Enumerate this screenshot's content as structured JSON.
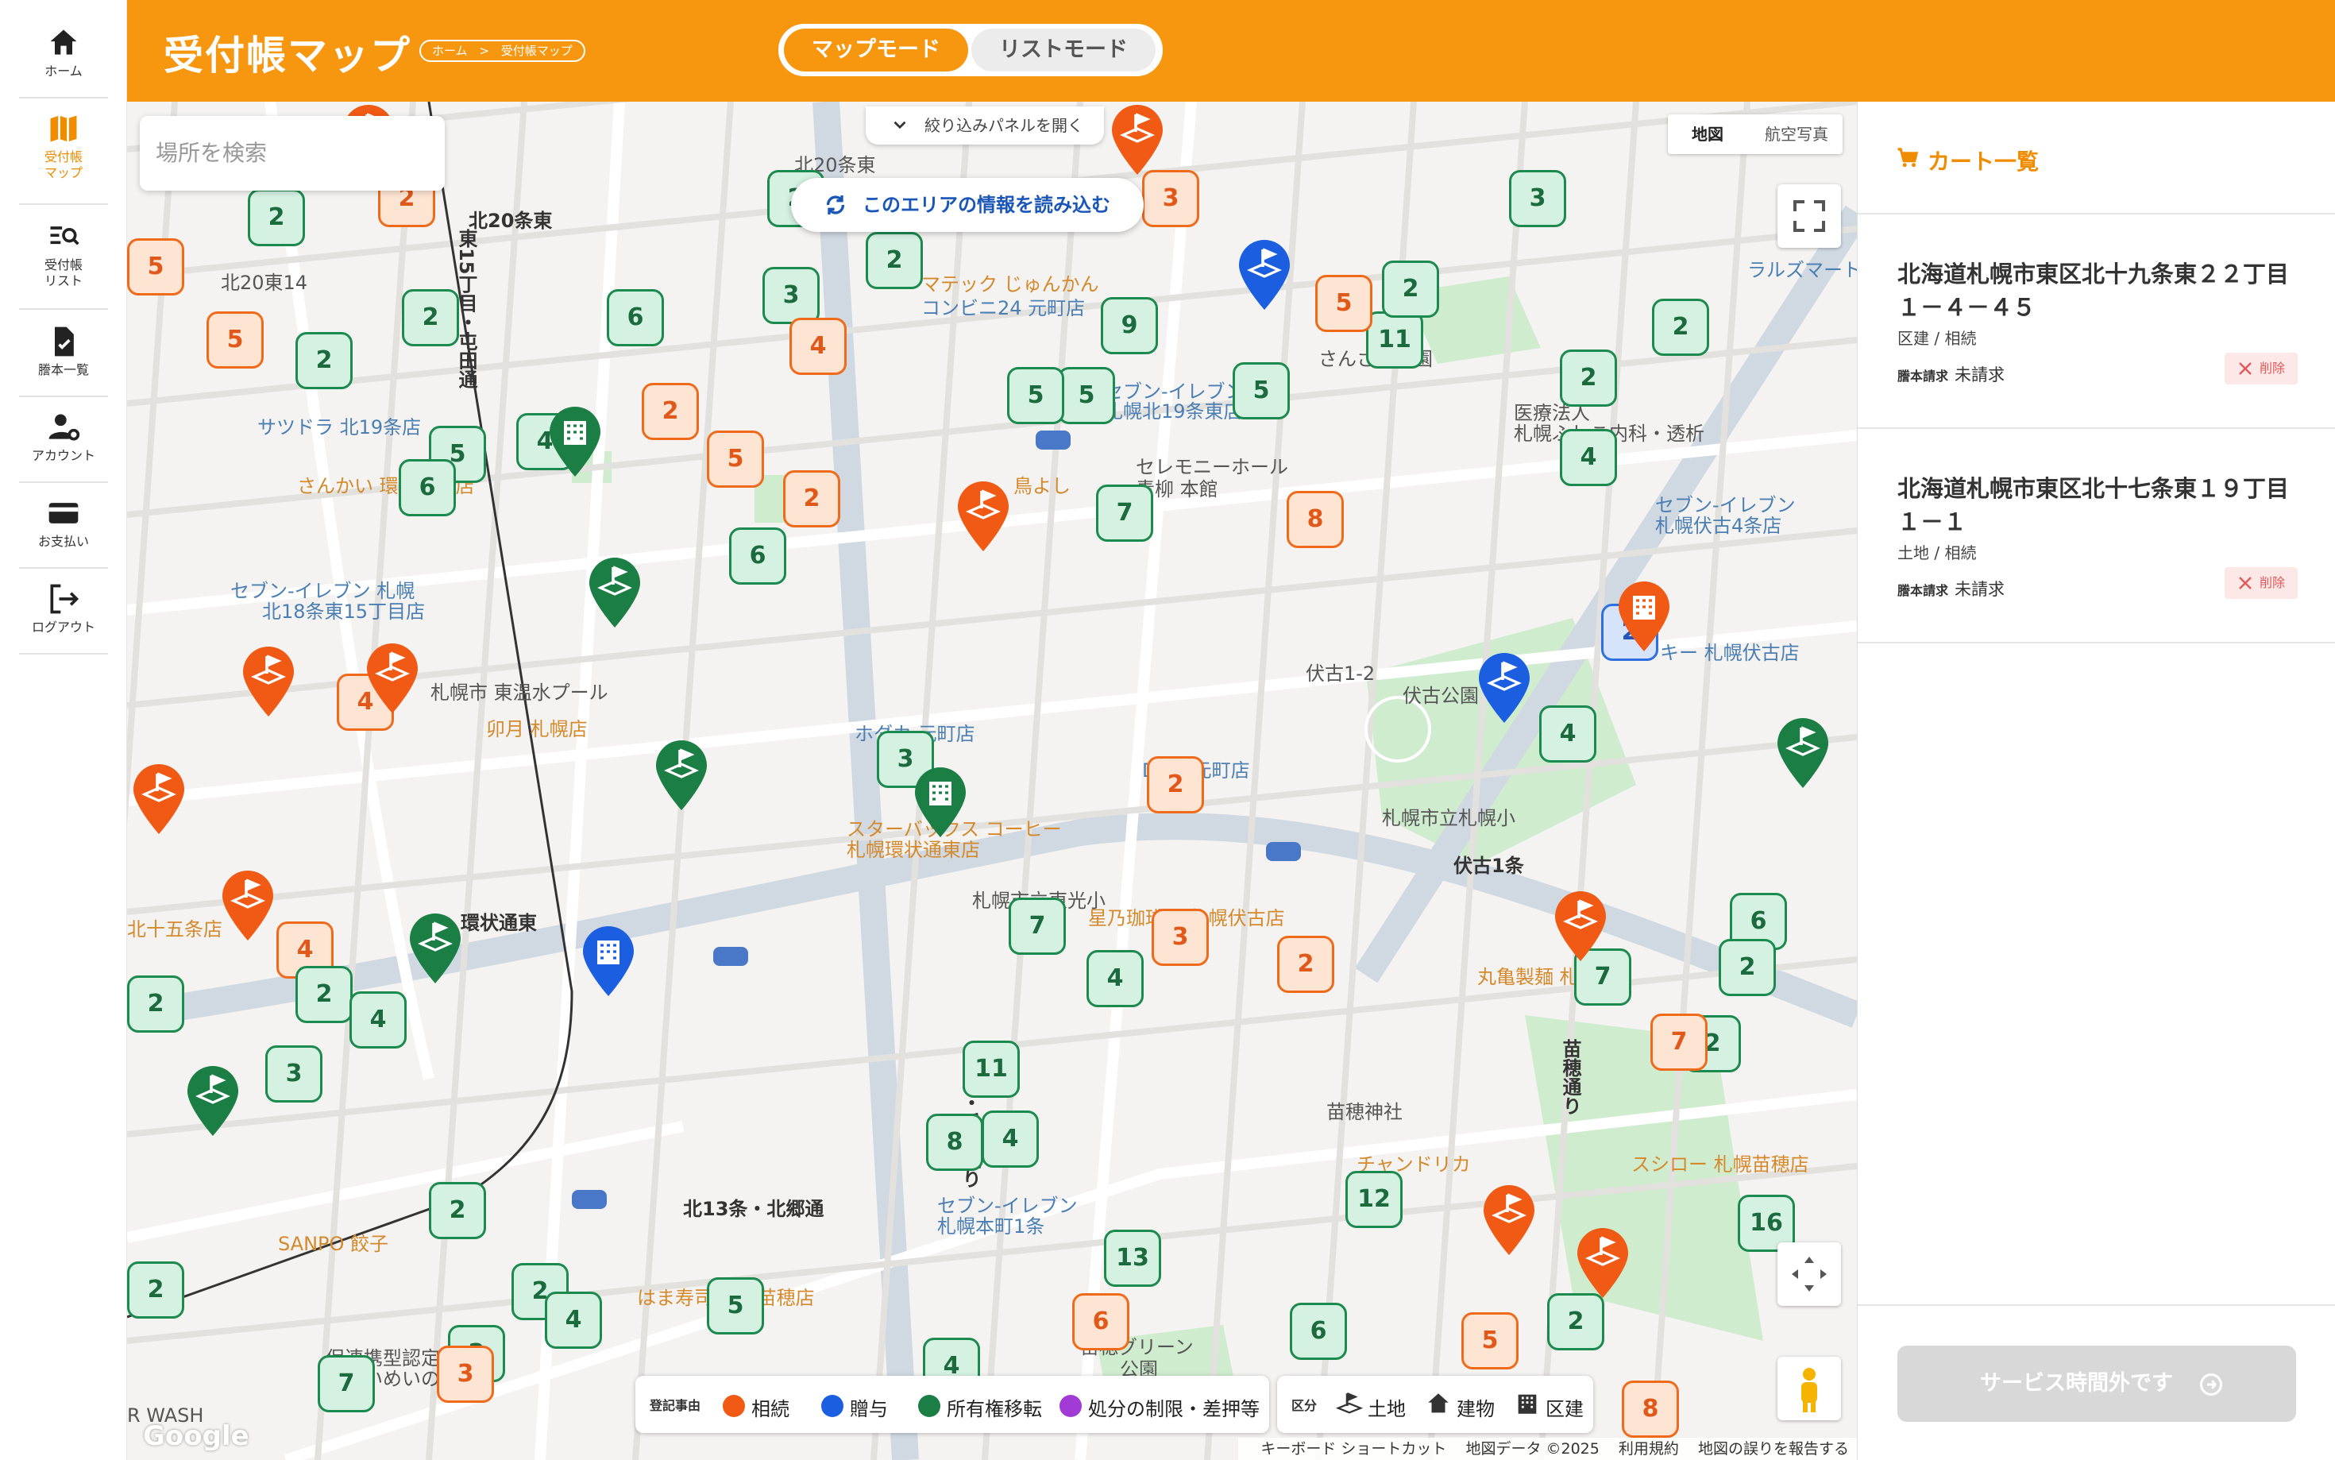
{
  "sidebar": {
    "items": [
      {
        "label": "ホーム",
        "icon": "home-icon"
      },
      {
        "label": "受付帳\nマップ",
        "icon": "map-icon",
        "active": true
      },
      {
        "label": "受付帳\nリスト",
        "icon": "list-search-icon"
      },
      {
        "label": "謄本一覧",
        "icon": "document-check-icon"
      },
      {
        "label": "アカウント",
        "icon": "user-gear-icon"
      },
      {
        "label": "お支払い",
        "icon": "credit-card-icon"
      },
      {
        "label": "ログアウト",
        "icon": "logout-icon"
      }
    ]
  },
  "header": {
    "title": "受付帳マップ",
    "breadcrumb": [
      "ホーム",
      "受付帳マップ"
    ],
    "breadcrumb_sep": ">",
    "mode_map": "マップモード",
    "mode_list": "リストモード",
    "accent_color": "#f7960f"
  },
  "map": {
    "search_placeholder": "場所を検索",
    "filter_toggle_label": "絞り込みパネルを開く",
    "load_area_label": "このエリアの情報を読み込む",
    "maptype_map": "地図",
    "maptype_aerial": "航空写真",
    "google_logo": "Google",
    "attribution": [
      "キーボード ショートカット",
      "地図データ ©2025",
      "利用規約",
      "地図の誤りを報告する"
    ],
    "labels": [
      {
        "text": "北20条東",
        "style": ""
      },
      {
        "text": "北20東14",
        "style": ""
      },
      {
        "text": "東15丁目・屯田通",
        "style": "road"
      },
      {
        "text": "北20条東",
        "style": "road"
      },
      {
        "text": "マテック じゅんかん",
        "style": "orange"
      },
      {
        "text": "コンビニ24 元町店",
        "style": "blue"
      },
      {
        "text": "サツドラ 北19条店",
        "style": "blue"
      },
      {
        "text": "さんかい 環状通東店",
        "style": "orange"
      },
      {
        "text": "セブン-イレブン",
        "style": "blue"
      },
      {
        "text": "札幌北19条東店",
        "style": "blue"
      },
      {
        "text": "セレモニーホール",
        "style": ""
      },
      {
        "text": "青柳 本館",
        "style": ""
      },
      {
        "text": "鳥よし",
        "style": "orange"
      },
      {
        "text": "さんさん公園",
        "style": ""
      },
      {
        "text": "医療法人",
        "style": ""
      },
      {
        "text": "札幌ふしこ内科・透析",
        "style": ""
      },
      {
        "text": "セブン-イレブン",
        "style": "blue"
      },
      {
        "text": "札幌伏古4条店",
        "style": "blue"
      },
      {
        "text": "ラルズマート",
        "style": "blue"
      },
      {
        "text": "セブン-イレブン 札幌",
        "style": "blue"
      },
      {
        "text": "北18条東15丁目店",
        "style": "blue"
      },
      {
        "text": "札幌市 東温水プール",
        "style": ""
      },
      {
        "text": "卯月 札幌店",
        "style": "orange"
      },
      {
        "text": "ホダカ 元町店",
        "style": "blue"
      },
      {
        "text": "DCM 元町店",
        "style": "blue"
      },
      {
        "text": "伏古公園",
        "style": ""
      },
      {
        "text": "伏古1-2",
        "style": ""
      },
      {
        "text": "ラッキー 札幌伏古店",
        "style": "blue"
      },
      {
        "text": "札幌市立札幌小",
        "style": ""
      },
      {
        "text": "伏古1条",
        "style": "road"
      },
      {
        "text": "スターバックス コーヒー",
        "style": "orange"
      },
      {
        "text": "札幌環状通東店",
        "style": "orange"
      },
      {
        "text": "札幌市立東光小",
        "style": ""
      },
      {
        "text": "星乃珈琲店 札幌伏古店",
        "style": "orange"
      },
      {
        "text": "丸亀製麺 札幌",
        "style": "orange"
      },
      {
        "text": "環状通東",
        "style": "road"
      },
      {
        "text": "北十五条店",
        "style": "orange"
      },
      {
        "text": "苗穂・丘珠通り",
        "style": "road"
      },
      {
        "text": "苗穂通り",
        "style": "road"
      },
      {
        "text": "苗穂神社",
        "style": ""
      },
      {
        "text": "チャンドリカ",
        "style": "orange"
      },
      {
        "text": "スシロー 札幌苗穂店",
        "style": "orange"
      },
      {
        "text": "北13条・北郷通",
        "style": "road"
      },
      {
        "text": "セブン-イレブン",
        "style": "blue"
      },
      {
        "text": "札幌本町1条",
        "style": "blue"
      },
      {
        "text": "SANPO 餃子",
        "style": "orange"
      },
      {
        "text": "はま寿司 札幌苗穂店",
        "style": "orange"
      },
      {
        "text": "保連携型認定こども",
        "style": ""
      },
      {
        "text": "園せいめいのもり",
        "style": ""
      },
      {
        "text": "苗穂グリーン",
        "style": ""
      },
      {
        "text": "公園",
        "style": ""
      },
      {
        "text": "R WASH",
        "style": ""
      }
    ],
    "count_markers": [
      {
        "n": "5",
        "k": "o"
      },
      {
        "n": "2",
        "k": "g"
      },
      {
        "n": "2",
        "k": "o"
      },
      {
        "n": "2",
        "k": "g"
      },
      {
        "n": "3",
        "k": "o"
      },
      {
        "n": "3",
        "k": "g"
      },
      {
        "n": "5",
        "k": "o"
      },
      {
        "n": "2",
        "k": "g"
      },
      {
        "n": "3",
        "k": "g"
      },
      {
        "n": "9",
        "k": "g"
      },
      {
        "n": "5",
        "k": "g"
      },
      {
        "n": "6",
        "k": "g"
      },
      {
        "n": "2",
        "k": "g"
      },
      {
        "n": "5",
        "k": "g"
      },
      {
        "n": "11",
        "k": "g"
      },
      {
        "n": "2",
        "k": "o"
      },
      {
        "n": "2",
        "k": "g"
      },
      {
        "n": "4",
        "k": "o"
      },
      {
        "n": "2",
        "k": "g"
      },
      {
        "n": "4",
        "k": "g"
      },
      {
        "n": "5",
        "k": "g"
      },
      {
        "n": "5",
        "k": "g"
      },
      {
        "n": "5",
        "k": "o"
      },
      {
        "n": "6",
        "k": "g"
      },
      {
        "n": "5",
        "k": "o"
      },
      {
        "n": "2",
        "k": "o"
      },
      {
        "n": "6",
        "k": "g"
      },
      {
        "n": "7",
        "k": "g"
      },
      {
        "n": "8",
        "k": "o"
      },
      {
        "n": "4",
        "k": "g"
      },
      {
        "n": "2",
        "k": "g"
      },
      {
        "n": "2",
        "k": "g"
      },
      {
        "n": "4",
        "k": "o"
      },
      {
        "n": "3",
        "k": "g"
      },
      {
        "n": "2",
        "k": "o"
      },
      {
        "n": "4",
        "k": "g"
      },
      {
        "n": "7",
        "k": "g"
      },
      {
        "n": "4",
        "k": "g"
      },
      {
        "n": "8",
        "k": "g"
      },
      {
        "n": "2",
        "k": "o"
      },
      {
        "n": "7",
        "k": "g"
      },
      {
        "n": "2",
        "k": "b"
      },
      {
        "n": "6",
        "k": "g"
      },
      {
        "n": "2",
        "k": "g"
      },
      {
        "n": "2",
        "k": "g"
      },
      {
        "n": "4",
        "k": "o"
      },
      {
        "n": "2",
        "k": "g"
      },
      {
        "n": "3",
        "k": "g"
      },
      {
        "n": "3",
        "k": "o"
      },
      {
        "n": "2",
        "k": "g"
      },
      {
        "n": "7",
        "k": "o"
      },
      {
        "n": "4",
        "k": "g"
      },
      {
        "n": "4",
        "k": "g"
      },
      {
        "n": "11",
        "k": "g"
      },
      {
        "n": "12",
        "k": "g"
      },
      {
        "n": "16",
        "k": "g"
      },
      {
        "n": "2",
        "k": "g"
      },
      {
        "n": "6",
        "k": "o"
      },
      {
        "n": "2",
        "k": "g"
      },
      {
        "n": "2",
        "k": "g"
      },
      {
        "n": "13",
        "k": "g"
      },
      {
        "n": "5",
        "k": "g"
      },
      {
        "n": "4",
        "k": "g"
      },
      {
        "n": "2",
        "k": "g"
      },
      {
        "n": "6",
        "k": "g"
      },
      {
        "n": "5",
        "k": "o"
      },
      {
        "n": "7",
        "k": "g"
      },
      {
        "n": "3",
        "k": "o"
      },
      {
        "n": "2",
        "k": "g"
      },
      {
        "n": "4",
        "k": "g"
      },
      {
        "n": "8",
        "k": "o"
      }
    ],
    "pins": [
      {
        "color": "#f05a14",
        "icon": "land-flag-icon"
      },
      {
        "color": "#f05a14",
        "icon": "land-flag-icon"
      },
      {
        "color": "#1b5ee0",
        "icon": "land-flag-icon"
      },
      {
        "color": "#1b7f45",
        "icon": "building-icon"
      },
      {
        "color": "#1b7f45",
        "icon": "land-flag-icon"
      },
      {
        "color": "#f05a14",
        "icon": "land-flag-icon"
      },
      {
        "color": "#f05a14",
        "icon": "land-flag-icon"
      },
      {
        "color": "#f05a14",
        "icon": "land-flag-icon"
      },
      {
        "color": "#1b7f45",
        "icon": "land-flag-icon"
      },
      {
        "color": "#1b7f45",
        "icon": "building-icon"
      },
      {
        "color": "#1b5ee0",
        "icon": "land-flag-icon"
      },
      {
        "color": "#f05a14",
        "icon": "building-icon"
      },
      {
        "color": "#1b7f45",
        "icon": "land-flag-icon"
      },
      {
        "color": "#f05a14",
        "icon": "land-flag-icon"
      },
      {
        "color": "#f05a14",
        "icon": "land-flag-icon"
      },
      {
        "color": "#1b7f45",
        "icon": "land-flag-icon"
      },
      {
        "color": "#1b5ee0",
        "icon": "building-icon"
      },
      {
        "color": "#1b7f45",
        "icon": "land-flag-icon"
      },
      {
        "color": "#f05a14",
        "icon": "land-flag-icon"
      },
      {
        "color": "#f05a14",
        "icon": "land-flag-icon"
      },
      {
        "color": "#f05a14",
        "icon": "land-flag-icon"
      }
    ],
    "legend": {
      "title": "登記事由",
      "items": [
        {
          "label": "相続",
          "color": "#f05a14"
        },
        {
          "label": "贈与",
          "color": "#1b5ee0"
        },
        {
          "label": "所有権移転",
          "color": "#1b7f45"
        },
        {
          "label": "処分の制限・差押等",
          "color": "#a23ad6"
        }
      ],
      "kind_title": "区分",
      "kinds": [
        {
          "label": "土地",
          "icon": "land-flag-icon"
        },
        {
          "label": "建物",
          "icon": "house-icon"
        },
        {
          "label": "区建",
          "icon": "apartment-icon"
        }
      ]
    }
  },
  "cart": {
    "title": "カート一覧",
    "items": [
      {
        "address": "北海道札幌市東区北十九条東２２丁目１－４－４５",
        "type": "区建 / 相続",
        "req_label": "謄本請求",
        "req_value": "未請求",
        "delete_label": "削除"
      },
      {
        "address": "北海道札幌市東区北十七条東１９丁目１－１",
        "type": "土地 / 相続",
        "req_label": "謄本請求",
        "req_value": "未請求",
        "delete_label": "削除"
      }
    ],
    "service_button": "サービス時間外です"
  }
}
